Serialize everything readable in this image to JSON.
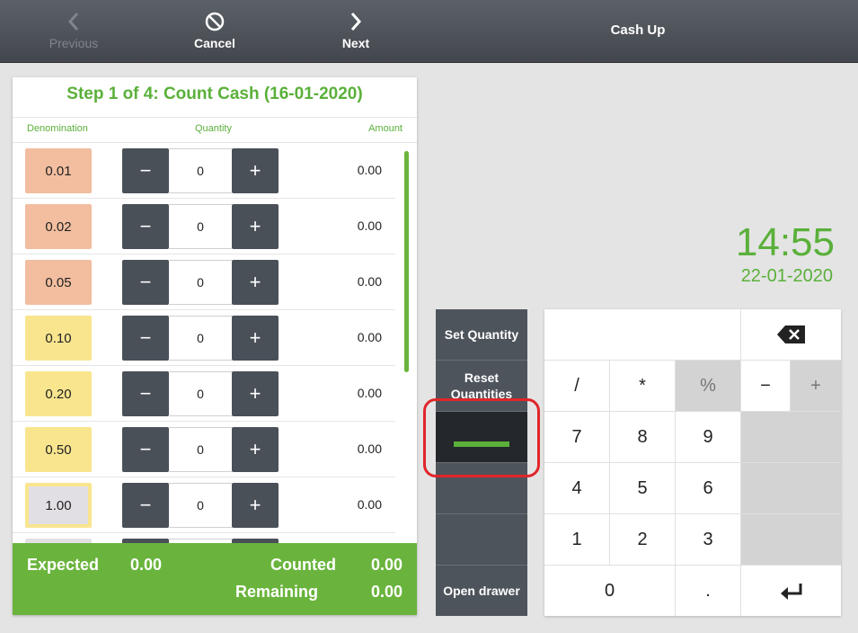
{
  "topbar": {
    "previous_label": "Previous",
    "cancel_label": "Cancel",
    "next_label": "Next",
    "title": "Cash Up"
  },
  "panel": {
    "title": "Step 1 of 4: Count Cash (16-01-2020)",
    "col_denomination": "Denomination",
    "col_quantity": "Quantity",
    "col_amount": "Amount",
    "rows": [
      {
        "denomination": "0.01",
        "quantity": "0",
        "amount": "0.00",
        "color": "#f2be9f"
      },
      {
        "denomination": "0.02",
        "quantity": "0",
        "amount": "0.00",
        "color": "#f2be9f"
      },
      {
        "denomination": "0.05",
        "quantity": "0",
        "amount": "0.00",
        "color": "#f2be9f"
      },
      {
        "denomination": "0.10",
        "quantity": "0",
        "amount": "0.00",
        "color": "#f8e58e"
      },
      {
        "denomination": "0.20",
        "quantity": "0",
        "amount": "0.00",
        "color": "#f8e58e"
      },
      {
        "denomination": "0.50",
        "quantity": "0",
        "amount": "0.00",
        "color": "#f8e58e"
      },
      {
        "denomination": "1.00",
        "quantity": "0",
        "amount": "0.00",
        "color": "#e2dfe4"
      }
    ],
    "minus_symbol": "−",
    "plus_symbol": "+"
  },
  "footer": {
    "expected_label": "Expected",
    "expected_value": "0.00",
    "counted_label": "Counted",
    "counted_value": "0.00",
    "remaining_label": "Remaining",
    "remaining_value": "0.00"
  },
  "actions": {
    "set_quantity": "Set Quantity",
    "reset_quantities": "Reset Quantities",
    "open_drawer": "Open drawer"
  },
  "clock": {
    "time": "14:55",
    "date": "22-01-2020"
  },
  "keypad": {
    "display_value": "",
    "keys": {
      "slash": "/",
      "star": "*",
      "percent": "%",
      "minus": "−",
      "plus": "+",
      "k7": "7",
      "k8": "8",
      "k9": "9",
      "k4": "4",
      "k5": "5",
      "k6": "6",
      "k1": "1",
      "k2": "2",
      "k3": "3",
      "k0": "0",
      "dot": "."
    }
  },
  "colors": {
    "accent_green": "#6ab43d",
    "highlight_red": "#e0262a",
    "dark_button": "#4a5058"
  }
}
